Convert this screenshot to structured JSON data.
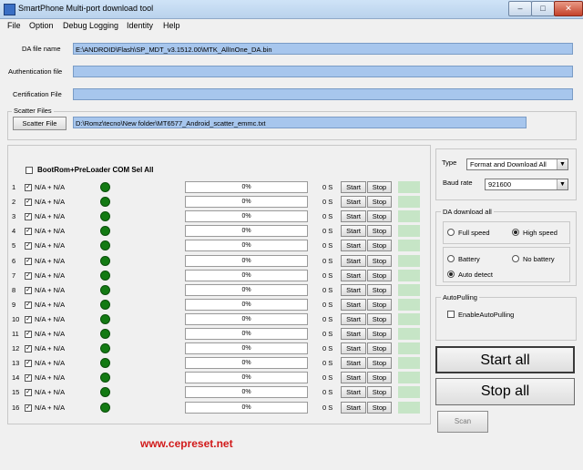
{
  "window": {
    "title": "SmartPhone Multi-port download tool"
  },
  "menu": [
    "File",
    "Option",
    "Debug Logging",
    "Identity",
    "Help"
  ],
  "fields": {
    "da_label": "DA file name",
    "da_value": "E:\\ANDROID\\Flash\\SP_MDT_v3.1512.00\\MTK_AllInOne_DA.bin",
    "auth_label": "Authentication file",
    "auth_value": "",
    "cert_label": "Certification File",
    "cert_value": ""
  },
  "scatter": {
    "group_title": "Scatter Files",
    "button": "Scatter File",
    "value": "D:\\Romz\\tecno\\New folder\\MT6577_Android_scatter_emmc.txt"
  },
  "ports": {
    "select_all_label": "BootRom+PreLoader COM Sel All",
    "rows": [
      {
        "num": "1",
        "port": "N/A + N/A",
        "progress": "0%",
        "time": "0 S"
      },
      {
        "num": "2",
        "port": "N/A + N/A",
        "progress": "0%",
        "time": "0 S"
      },
      {
        "num": "3",
        "port": "N/A + N/A",
        "progress": "0%",
        "time": "0 S"
      },
      {
        "num": "4",
        "port": "N/A + N/A",
        "progress": "0%",
        "time": "0 S"
      },
      {
        "num": "5",
        "port": "N/A + N/A",
        "progress": "0%",
        "time": "0 S"
      },
      {
        "num": "6",
        "port": "N/A + N/A",
        "progress": "0%",
        "time": "0 S"
      },
      {
        "num": "7",
        "port": "N/A + N/A",
        "progress": "0%",
        "time": "0 S"
      },
      {
        "num": "8",
        "port": "N/A + N/A",
        "progress": "0%",
        "time": "0 S"
      },
      {
        "num": "9",
        "port": "N/A + N/A",
        "progress": "0%",
        "time": "0 S"
      },
      {
        "num": "10",
        "port": "N/A + N/A",
        "progress": "0%",
        "time": "0 S"
      },
      {
        "num": "11",
        "port": "N/A + N/A",
        "progress": "0%",
        "time": "0 S"
      },
      {
        "num": "12",
        "port": "N/A + N/A",
        "progress": "0%",
        "time": "0 S"
      },
      {
        "num": "13",
        "port": "N/A + N/A",
        "progress": "0%",
        "time": "0 S"
      },
      {
        "num": "14",
        "port": "N/A + N/A",
        "progress": "0%",
        "time": "0 S"
      },
      {
        "num": "15",
        "port": "N/A + N/A",
        "progress": "0%",
        "time": "0 S"
      },
      {
        "num": "16",
        "port": "N/A + N/A",
        "progress": "0%",
        "time": "0 S"
      }
    ],
    "start_label": "Start",
    "stop_label": "Stop"
  },
  "settings": {
    "type_label": "Type",
    "type_value": "Format and Download All",
    "baud_label": "Baud rate",
    "baud_value": "921600",
    "da_download_title": "DA download all",
    "full_speed": "Full speed",
    "high_speed": "High speed",
    "battery": "Battery",
    "no_battery": "No battery",
    "auto_detect": "Auto detect",
    "autopulling_title": "AutoPulling",
    "enable_autopulling": "EnableAutoPulling"
  },
  "actions": {
    "start_all": "Start all",
    "stop_all": "Stop all",
    "scan": "Scan"
  },
  "watermark": "www.cepreset.net",
  "colors": {
    "field_bg": "#a7c6ed",
    "led": "#137a13",
    "status_cell": "#c6e5c6",
    "watermark": "#d11a1a"
  }
}
